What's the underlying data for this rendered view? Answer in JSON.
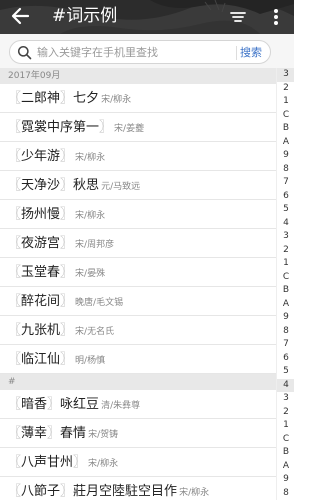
{
  "topbar": {
    "title": "#词示例",
    "icons": [
      "back-arrow-icon",
      "filter-lines-icon",
      "more-vertical-icon"
    ],
    "bg_color": "#2c2c2c"
  },
  "search": {
    "placeholder": "输入关键字在手机里查找",
    "button": "搜索"
  },
  "sections": [
    {
      "header": "2017年09月",
      "rows": [
        {
          "cipai": "二郎神",
          "title": "七夕",
          "author": "宋/柳永"
        },
        {
          "cipai": "霓裳中序第一",
          "title": "",
          "author": "宋/姜夔"
        },
        {
          "cipai": "少年游",
          "title": "",
          "author": "宋/柳永"
        },
        {
          "cipai": "天净沙",
          "title": "秋思",
          "author": "元/马致远"
        },
        {
          "cipai": "扬州慢",
          "title": "",
          "author": "宋/柳永"
        },
        {
          "cipai": "夜游宫",
          "title": "",
          "author": "宋/周邦彦"
        },
        {
          "cipai": "玉堂春",
          "title": "",
          "author": "宋/晏殊"
        },
        {
          "cipai": "醉花间",
          "title": "",
          "author": "晚唐/毛文锡"
        },
        {
          "cipai": "九张机",
          "title": "",
          "author": "宋/无名氏"
        },
        {
          "cipai": "临江仙",
          "title": "",
          "author": "明/杨慎"
        }
      ]
    },
    {
      "header": "#",
      "rows": [
        {
          "cipai": "暗香",
          "title": "咏红豆",
          "author": "清/朱彝尊"
        },
        {
          "cipai": "薄幸",
          "title": "春情",
          "author": "宋/贺铸"
        },
        {
          "cipai": "八声甘州",
          "title": "",
          "author": "宋/柳永"
        },
        {
          "cipai": "八節子",
          "title": "莊月空陸駐空目作",
          "author": "宋/柳永"
        }
      ]
    }
  ],
  "bracket_open": "〖",
  "bracket_close": "〗",
  "index": [
    "3",
    "2",
    "1",
    "C",
    "B",
    "A",
    "9",
    "8",
    "7",
    "6",
    "5",
    "4",
    "3",
    "2",
    "1",
    "C",
    "B",
    "A",
    "9",
    "8",
    "7",
    "6",
    "5",
    "4",
    "3",
    "2",
    "1",
    "C",
    "B",
    "A",
    "9",
    "8"
  ],
  "index_highlight": [
    0,
    23
  ]
}
